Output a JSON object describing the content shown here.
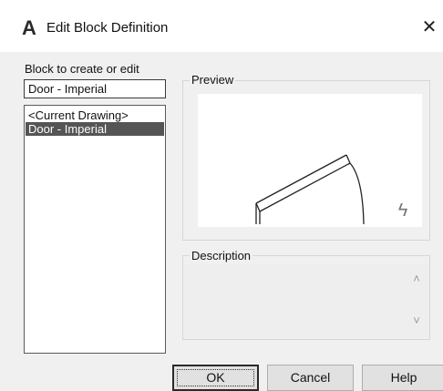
{
  "window": {
    "title": "Edit Block Definition",
    "app_icon_glyph": "A",
    "app_icon_name": "autocad-icon",
    "close_glyph": "✕"
  },
  "block_selector": {
    "label": "Block to create or edit",
    "name_value": "Door - Imperial",
    "list_items": [
      {
        "label": "<Current Drawing>",
        "selected": false
      },
      {
        "label": "Door - Imperial",
        "selected": true
      }
    ]
  },
  "preview": {
    "label": "Preview",
    "corner_icon": "lightning-icon",
    "corner_glyph": "ϟ"
  },
  "description": {
    "label": "Description",
    "value": "",
    "scroll_up_glyph": "˄",
    "scroll_down_glyph": "˅"
  },
  "buttons": {
    "ok": "OK",
    "cancel": "Cancel",
    "help": "Help"
  },
  "colors": {
    "dialog_bg": "#f0f0f0",
    "selection_bg": "#555555",
    "button_bg": "#e1e1e1"
  }
}
